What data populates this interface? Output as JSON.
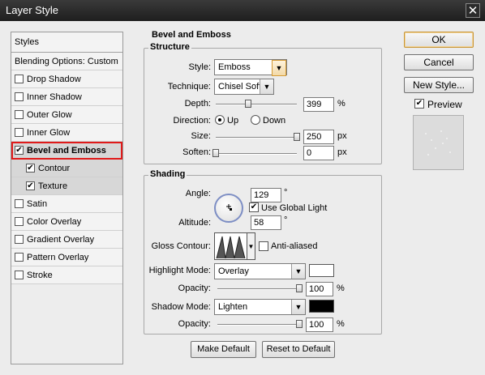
{
  "window": {
    "title": "Layer Style",
    "close_glyph": "✕"
  },
  "styles_panel": {
    "header": "Styles",
    "items": [
      {
        "label": "Blending Options: Custom",
        "checkbox": false,
        "checked": false
      },
      {
        "label": "Drop Shadow",
        "checkbox": true,
        "checked": false
      },
      {
        "label": "Inner Shadow",
        "checkbox": true,
        "checked": false
      },
      {
        "label": "Outer Glow",
        "checkbox": true,
        "checked": false
      },
      {
        "label": "Inner Glow",
        "checkbox": true,
        "checked": false
      },
      {
        "label": "Bevel and Emboss",
        "checkbox": true,
        "checked": true,
        "selected": true
      },
      {
        "label": "Contour",
        "checkbox": true,
        "checked": true,
        "sub": true
      },
      {
        "label": "Texture",
        "checkbox": true,
        "checked": true,
        "sub": true
      },
      {
        "label": "Satin",
        "checkbox": true,
        "checked": false
      },
      {
        "label": "Color Overlay",
        "checkbox": true,
        "checked": false
      },
      {
        "label": "Gradient Overlay",
        "checkbox": true,
        "checked": false
      },
      {
        "label": "Pattern Overlay",
        "checkbox": true,
        "checked": false
      },
      {
        "label": "Stroke",
        "checkbox": true,
        "checked": false
      }
    ],
    "check_glyph": "✔"
  },
  "bevel": {
    "section_title": "Bevel and Emboss",
    "structure": {
      "title": "Structure",
      "style_label": "Style:",
      "style_value": "Emboss",
      "technique_label": "Technique:",
      "technique_value": "Chisel Soft",
      "depth_label": "Depth:",
      "depth_value": "399",
      "depth_unit": "%",
      "depth_slider": 0.4,
      "direction_label": "Direction:",
      "direction_up": "Up",
      "direction_down": "Down",
      "direction_selected": "Up",
      "size_label": "Size:",
      "size_value": "250",
      "size_unit": "px",
      "size_slider": 1.0,
      "soften_label": "Soften:",
      "soften_value": "0",
      "soften_unit": "px",
      "soften_slider": 0.0
    },
    "shading": {
      "title": "Shading",
      "angle_label": "Angle:",
      "angle_value": "129",
      "angle_unit": "°",
      "global_light_label": "Use Global Light",
      "global_light_checked": true,
      "altitude_label": "Altitude:",
      "altitude_value": "58",
      "altitude_unit": "°",
      "gloss_contour_label": "Gloss Contour:",
      "anti_aliased_label": "Anti-aliased",
      "anti_aliased_checked": false,
      "highlight_mode_label": "Highlight Mode:",
      "highlight_mode_value": "Overlay",
      "highlight_color": "#ffffff",
      "highlight_opacity_label": "Opacity:",
      "highlight_opacity_value": "100",
      "highlight_opacity_unit": "%",
      "highlight_opacity_slider": 1.0,
      "shadow_mode_label": "Shadow Mode:",
      "shadow_mode_value": "Lighten",
      "shadow_color": "#000000",
      "shadow_opacity_label": "Opacity:",
      "shadow_opacity_value": "100",
      "shadow_opacity_unit": "%",
      "shadow_opacity_slider": 1.0
    },
    "make_default": "Make Default",
    "reset_default": "Reset to Default"
  },
  "actions": {
    "ok": "OK",
    "cancel": "Cancel",
    "new_style": "New Style...",
    "preview_label": "Preview",
    "preview_checked": true
  },
  "icons": {
    "dropdown": "chevron-down-icon",
    "check": "checkmark-icon",
    "close": "close-icon"
  }
}
